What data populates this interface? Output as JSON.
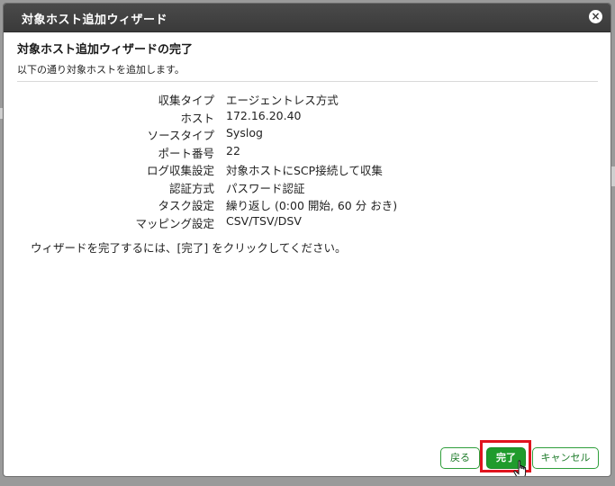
{
  "dialog": {
    "title": "対象ホスト追加ウィザード",
    "close_label": "×"
  },
  "page": {
    "heading": "対象ホスト追加ウィザードの完了",
    "subtitle": "以下の通り対象ホストを追加します。",
    "instruction": "ウィザードを完了するには、[完了] をクリックしてください。"
  },
  "summary": [
    {
      "label": "収集タイプ",
      "value": "エージェントレス方式"
    },
    {
      "label": "ホスト",
      "value": "172.16.20.40"
    },
    {
      "label": "ソースタイプ",
      "value": "Syslog"
    },
    {
      "label": "ポート番号",
      "value": "22"
    },
    {
      "label": "ログ収集設定",
      "value": "対象ホストにSCP接続して収集"
    },
    {
      "label": "認証方式",
      "value": "パスワード認証"
    },
    {
      "label": "タスク設定",
      "value": "繰り返し (0:00 開始, 60 分 おき)"
    },
    {
      "label": "マッピング設定",
      "value": "CSV/TSV/DSV"
    }
  ],
  "buttons": {
    "back": "戻る",
    "finish": "完了",
    "cancel": "キャンセル"
  },
  "colors": {
    "titlebar": "#3f3f3f",
    "accent_green": "#1f9b2c",
    "highlight_red": "#e0141e"
  }
}
